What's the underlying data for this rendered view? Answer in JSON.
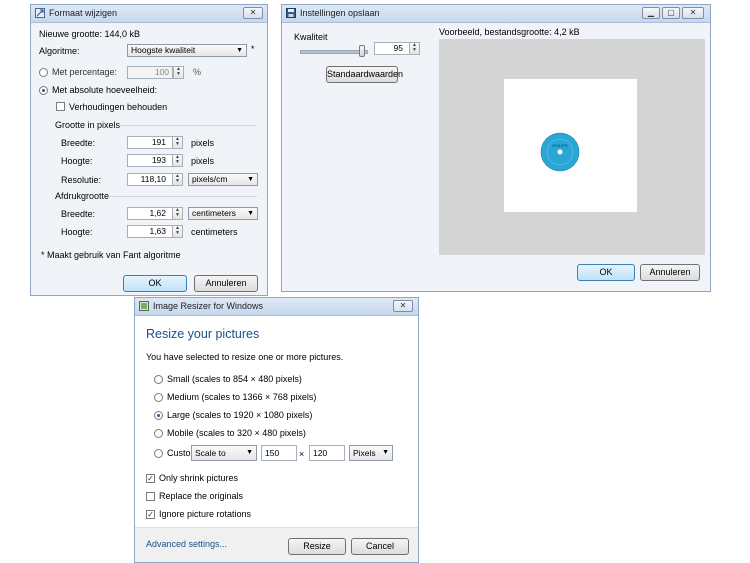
{
  "resize_dialog": {
    "title": "Formaat wijzigen",
    "new_size": "Nieuwe grootte: 144,0 kB",
    "algorithm_label": "Algoritme:",
    "algorithm_value": "Hoogste kwaliteit",
    "asterisk": "*",
    "percentage_label": "Met percentage:",
    "percentage_value": "100",
    "percent_unit": "%",
    "absolute_label": "Met absolute hoeveelheid:",
    "keep_ratio_label": "Verhoudingen behouden",
    "pixel_size_group": "Grootte in pixels",
    "width_label": "Breedte:",
    "width_value": "191",
    "width_unit": "pixels",
    "height_label": "Hoogte:",
    "height_value": "193",
    "height_unit": "pixels",
    "resolution_label": "Resolutie:",
    "resolution_value": "118,10",
    "resolution_unit": "pixels/cm",
    "print_size_group": "Afdrukgrootte",
    "print_width_label": "Breedte:",
    "print_width_value": "1,62",
    "print_width_unit": "centimeters",
    "print_height_label": "Hoogte:",
    "print_height_value": "1,63",
    "print_height_unit": "centimeters",
    "footnote": "* Maakt gebruik van Fant algoritme",
    "ok_label": "OK",
    "cancel_label": "Annuleren"
  },
  "save_dialog": {
    "title": "Instellingen opslaan",
    "quality_label": "Kwaliteit",
    "quality_value": "95",
    "quality_fraction": 0.95,
    "defaults_label": "Standaardwaarden",
    "preview_label": "Voorbeeld, bestandsgrootte: 4,2 kB",
    "disc_text": "PHILIPS",
    "ok_label": "OK",
    "cancel_label": "Annuleren"
  },
  "image_resizer": {
    "title": "Image Resizer for Windows",
    "heading": "Resize your pictures",
    "intro": "You have selected to resize one or more pictures.",
    "options": [
      {
        "label": "Small (scales to 854 × 480 pixels)",
        "selected": false
      },
      {
        "label": "Medium (scales to 1366 × 768 pixels)",
        "selected": false
      },
      {
        "label": "Large (scales to 1920 × 1080 pixels)",
        "selected": true
      },
      {
        "label": "Mobile (scales to 320 × 480 pixels)",
        "selected": false
      }
    ],
    "custom_label": "Custom:",
    "custom_mode": "Scale to",
    "custom_width": "150",
    "custom_times": "×",
    "custom_height": "120",
    "custom_unit": "Pixels",
    "only_shrink_label": "Only shrink pictures",
    "only_shrink_checked": true,
    "replace_label": "Replace the originals",
    "replace_checked": false,
    "ignore_rotation_label": "Ignore picture rotations",
    "ignore_rotation_checked": true,
    "advanced_label": "Advanced settings...",
    "resize_label": "Resize",
    "cancel_label": "Cancel"
  },
  "colors": {
    "accent_blue": "#1a4f8b",
    "preview_gray": "#d4d4d4",
    "disc_blue": "#2aa6d6"
  }
}
